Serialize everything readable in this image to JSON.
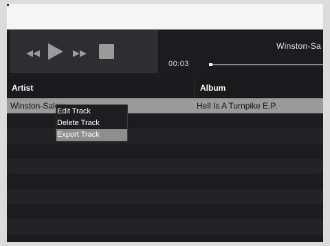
{
  "player": {
    "now_playing": "Winston-Sa",
    "elapsed": "00:03",
    "progress": 0.01
  },
  "table": {
    "columns": [
      "Artist",
      "Album"
    ],
    "rows": [
      {
        "artist": "Winston-Salem",
        "album": "Hell Is A Turnpike E.P."
      }
    ]
  },
  "context_menu": {
    "items": [
      "Edit Track",
      "Delete Track",
      "Export Track"
    ],
    "highlighted": "Export Track"
  },
  "colors": {
    "selected_row": "#9a9a9a",
    "menu_highlight": "#8e8e8e",
    "stop_button": "#9b9b9b"
  }
}
